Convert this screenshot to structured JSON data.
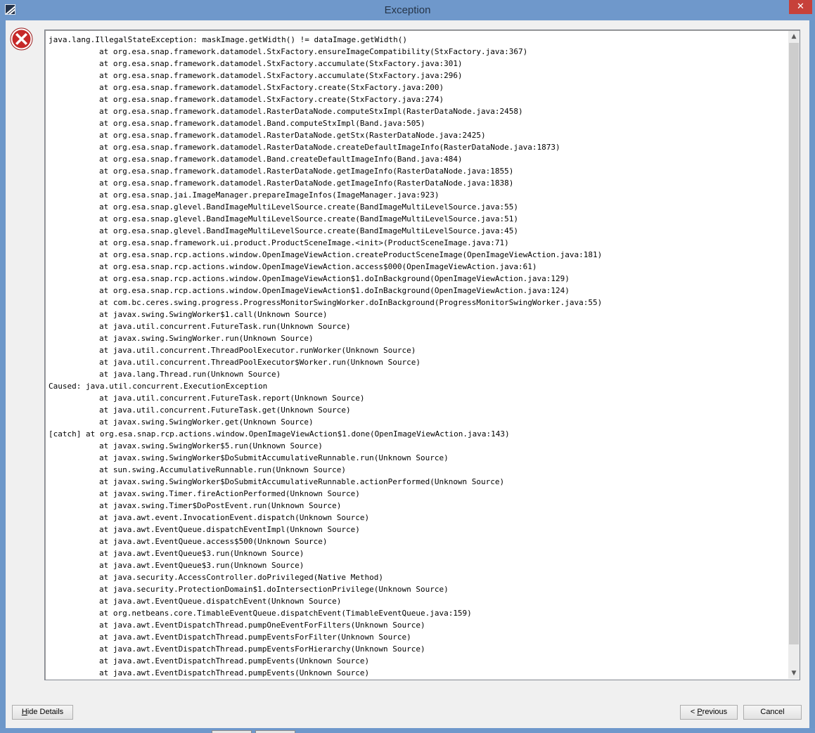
{
  "window": {
    "title": "Exception",
    "close_glyph": "✕",
    "app_icon": "snap-app-icon",
    "error_icon": "error-icon",
    "accent_colors": {
      "titlebar": "#6f98cb",
      "close": "#c7413a",
      "error": "#c62828"
    }
  },
  "trace": {
    "lines": [
      {
        "text": "java.lang.IllegalStateException: maskImage.getWidth() != dataImage.getWidth()",
        "indent": false
      },
      {
        "text": "at org.esa.snap.framework.datamodel.StxFactory.ensureImageCompatibility(StxFactory.java:367)",
        "indent": true
      },
      {
        "text": "at org.esa.snap.framework.datamodel.StxFactory.accumulate(StxFactory.java:301)",
        "indent": true
      },
      {
        "text": "at org.esa.snap.framework.datamodel.StxFactory.accumulate(StxFactory.java:296)",
        "indent": true
      },
      {
        "text": "at org.esa.snap.framework.datamodel.StxFactory.create(StxFactory.java:200)",
        "indent": true
      },
      {
        "text": "at org.esa.snap.framework.datamodel.StxFactory.create(StxFactory.java:274)",
        "indent": true
      },
      {
        "text": "at org.esa.snap.framework.datamodel.RasterDataNode.computeStxImpl(RasterDataNode.java:2458)",
        "indent": true
      },
      {
        "text": "at org.esa.snap.framework.datamodel.Band.computeStxImpl(Band.java:505)",
        "indent": true
      },
      {
        "text": "at org.esa.snap.framework.datamodel.RasterDataNode.getStx(RasterDataNode.java:2425)",
        "indent": true
      },
      {
        "text": "at org.esa.snap.framework.datamodel.RasterDataNode.createDefaultImageInfo(RasterDataNode.java:1873)",
        "indent": true
      },
      {
        "text": "at org.esa.snap.framework.datamodel.Band.createDefaultImageInfo(Band.java:484)",
        "indent": true
      },
      {
        "text": "at org.esa.snap.framework.datamodel.RasterDataNode.getImageInfo(RasterDataNode.java:1855)",
        "indent": true
      },
      {
        "text": "at org.esa.snap.framework.datamodel.RasterDataNode.getImageInfo(RasterDataNode.java:1838)",
        "indent": true
      },
      {
        "text": "at org.esa.snap.jai.ImageManager.prepareImageInfos(ImageManager.java:923)",
        "indent": true
      },
      {
        "text": "at org.esa.snap.glevel.BandImageMultiLevelSource.create(BandImageMultiLevelSource.java:55)",
        "indent": true
      },
      {
        "text": "at org.esa.snap.glevel.BandImageMultiLevelSource.create(BandImageMultiLevelSource.java:51)",
        "indent": true
      },
      {
        "text": "at org.esa.snap.glevel.BandImageMultiLevelSource.create(BandImageMultiLevelSource.java:45)",
        "indent": true
      },
      {
        "text": "at org.esa.snap.framework.ui.product.ProductSceneImage.<init>(ProductSceneImage.java:71)",
        "indent": true
      },
      {
        "text": "at org.esa.snap.rcp.actions.window.OpenImageViewAction.createProductSceneImage(OpenImageViewAction.java:181)",
        "indent": true
      },
      {
        "text": "at org.esa.snap.rcp.actions.window.OpenImageViewAction.access$000(OpenImageViewAction.java:61)",
        "indent": true
      },
      {
        "text": "at org.esa.snap.rcp.actions.window.OpenImageViewAction$1.doInBackground(OpenImageViewAction.java:129)",
        "indent": true
      },
      {
        "text": "at org.esa.snap.rcp.actions.window.OpenImageViewAction$1.doInBackground(OpenImageViewAction.java:124)",
        "indent": true
      },
      {
        "text": "at com.bc.ceres.swing.progress.ProgressMonitorSwingWorker.doInBackground(ProgressMonitorSwingWorker.java:55)",
        "indent": true
      },
      {
        "text": "at javax.swing.SwingWorker$1.call(Unknown Source)",
        "indent": true
      },
      {
        "text": "at java.util.concurrent.FutureTask.run(Unknown Source)",
        "indent": true
      },
      {
        "text": "at javax.swing.SwingWorker.run(Unknown Source)",
        "indent": true
      },
      {
        "text": "at java.util.concurrent.ThreadPoolExecutor.runWorker(Unknown Source)",
        "indent": true
      },
      {
        "text": "at java.util.concurrent.ThreadPoolExecutor$Worker.run(Unknown Source)",
        "indent": true
      },
      {
        "text": "at java.lang.Thread.run(Unknown Source)",
        "indent": true
      },
      {
        "text": "Caused: java.util.concurrent.ExecutionException",
        "indent": false
      },
      {
        "text": "at java.util.concurrent.FutureTask.report(Unknown Source)",
        "indent": true
      },
      {
        "text": "at java.util.concurrent.FutureTask.get(Unknown Source)",
        "indent": true
      },
      {
        "text": "at javax.swing.SwingWorker.get(Unknown Source)",
        "indent": true
      },
      {
        "text": "[catch] at org.esa.snap.rcp.actions.window.OpenImageViewAction$1.done(OpenImageViewAction.java:143)",
        "indent": false
      },
      {
        "text": "at javax.swing.SwingWorker$5.run(Unknown Source)",
        "indent": true
      },
      {
        "text": "at javax.swing.SwingWorker$DoSubmitAccumulativeRunnable.run(Unknown Source)",
        "indent": true
      },
      {
        "text": "at sun.swing.AccumulativeRunnable.run(Unknown Source)",
        "indent": true
      },
      {
        "text": "at javax.swing.SwingWorker$DoSubmitAccumulativeRunnable.actionPerformed(Unknown Source)",
        "indent": true
      },
      {
        "text": "at javax.swing.Timer.fireActionPerformed(Unknown Source)",
        "indent": true
      },
      {
        "text": "at javax.swing.Timer$DoPostEvent.run(Unknown Source)",
        "indent": true
      },
      {
        "text": "at java.awt.event.InvocationEvent.dispatch(Unknown Source)",
        "indent": true
      },
      {
        "text": "at java.awt.EventQueue.dispatchEventImpl(Unknown Source)",
        "indent": true
      },
      {
        "text": "at java.awt.EventQueue.access$500(Unknown Source)",
        "indent": true
      },
      {
        "text": "at java.awt.EventQueue$3.run(Unknown Source)",
        "indent": true
      },
      {
        "text": "at java.awt.EventQueue$3.run(Unknown Source)",
        "indent": true
      },
      {
        "text": "at java.security.AccessController.doPrivileged(Native Method)",
        "indent": true
      },
      {
        "text": "at java.security.ProtectionDomain$1.doIntersectionPrivilege(Unknown Source)",
        "indent": true
      },
      {
        "text": "at java.awt.EventQueue.dispatchEvent(Unknown Source)",
        "indent": true
      },
      {
        "text": "at org.netbeans.core.TimableEventQueue.dispatchEvent(TimableEventQueue.java:159)",
        "indent": true
      },
      {
        "text": "at java.awt.EventDispatchThread.pumpOneEventForFilters(Unknown Source)",
        "indent": true
      },
      {
        "text": "at java.awt.EventDispatchThread.pumpEventsForFilter(Unknown Source)",
        "indent": true
      },
      {
        "text": "at java.awt.EventDispatchThread.pumpEventsForHierarchy(Unknown Source)",
        "indent": true
      },
      {
        "text": "at java.awt.EventDispatchThread.pumpEvents(Unknown Source)",
        "indent": true
      },
      {
        "text": "at java.awt.EventDispatchThread.pumpEvents(Unknown Source)",
        "indent": true
      }
    ]
  },
  "scrollbar": {
    "up_glyph": "▲",
    "down_glyph": "▼"
  },
  "buttons": {
    "hide_details": {
      "mnemonic": "H",
      "rest": "ide Details"
    },
    "previous": {
      "prefix": "< ",
      "mnemonic": "P",
      "rest": "revious"
    },
    "cancel": {
      "label": "Cancel"
    }
  }
}
